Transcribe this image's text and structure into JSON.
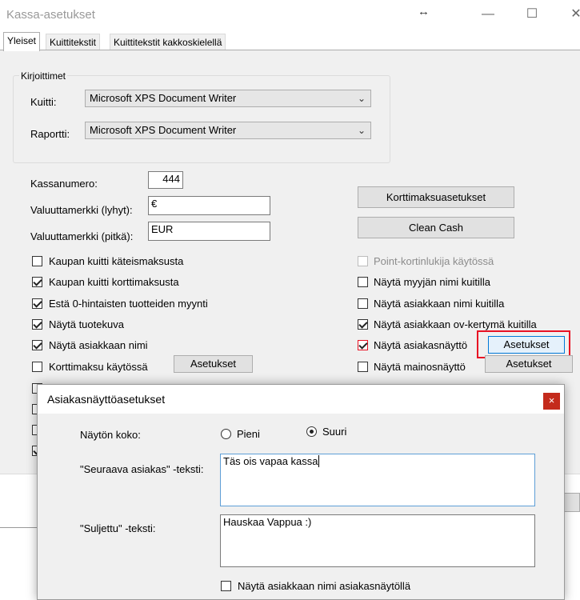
{
  "window": {
    "title": "Kassa-asetukset",
    "resize_glyph": "↔",
    "minimize_glyph": "—",
    "maximize_glyph": "☐",
    "close_glyph": "✕"
  },
  "tabs": [
    {
      "label": "Yleiset"
    },
    {
      "label": "Kuittitekstit"
    },
    {
      "label": "Kuittitekstit kakkoskielellä"
    }
  ],
  "printers": {
    "group_label": "Kirjoittimet",
    "receipt_label": "Kuitti:",
    "receipt_value": "Microsoft XPS Document Writer",
    "report_label": "Raportti:",
    "report_value": "Microsoft XPS Document Writer"
  },
  "fields": {
    "register_label": "Kassanumero:",
    "register_value": "444",
    "currency_short_label": "Valuuttamerkki (lyhyt):",
    "currency_short_value": "€",
    "currency_long_label": "Valuuttamerkki (pitkä):",
    "currency_long_value": "EUR"
  },
  "buttons": {
    "card_settings": "Korttimaksuasetukset",
    "clean_cash": "Clean Cash",
    "settings_left": "Asetukset",
    "settings_right_1": "Asetukset",
    "settings_right_2": "Asetukset"
  },
  "left_checks": [
    {
      "label": "Kaupan kuitti käteismaksusta",
      "checked": false
    },
    {
      "label": "Kaupan kuitti korttimaksusta",
      "checked": true
    },
    {
      "label": "Estä 0-hintaisten tuotteiden myynti",
      "checked": true
    },
    {
      "label": "Näytä tuotekuva",
      "checked": true
    },
    {
      "label": "Näytä asiakkaan nimi",
      "checked": true
    },
    {
      "label": "Korttimaksu käytössä",
      "checked": false
    }
  ],
  "right_checks": [
    {
      "label": "Point-kortinlukija käytössä",
      "checked": false,
      "disabled": true
    },
    {
      "label": "Näytä myyjän nimi kuitilla",
      "checked": false
    },
    {
      "label": "Näytä asiakkaan nimi kuitilla",
      "checked": false
    },
    {
      "label": "Näytä asiakkaan ov-kertymä kuitilla",
      "checked": true
    },
    {
      "label": "Näytä asiakasnäyttö",
      "checked": true
    },
    {
      "label": "Näytä mainosnäyttö",
      "checked": false
    }
  ],
  "dialog": {
    "title": "Asiakasnäyttöasetukset",
    "close_glyph": "×",
    "size_label": "Näytön koko:",
    "size_small": "Pieni",
    "size_large": "Suuri",
    "size_selected": "Suuri",
    "next_label": "\"Seuraava asiakas\" -teksti:",
    "next_value": "Täs ois vapaa kassa",
    "closed_label": "\"Suljettu\" -teksti:",
    "closed_value": "Hauskaa Vappua :)",
    "show_name_label": "Näytä asiakkaan nimi asiakasnäytöllä"
  },
  "colors": {
    "highlight": "#e81123",
    "dialog_close_bg": "#c42b1c"
  }
}
